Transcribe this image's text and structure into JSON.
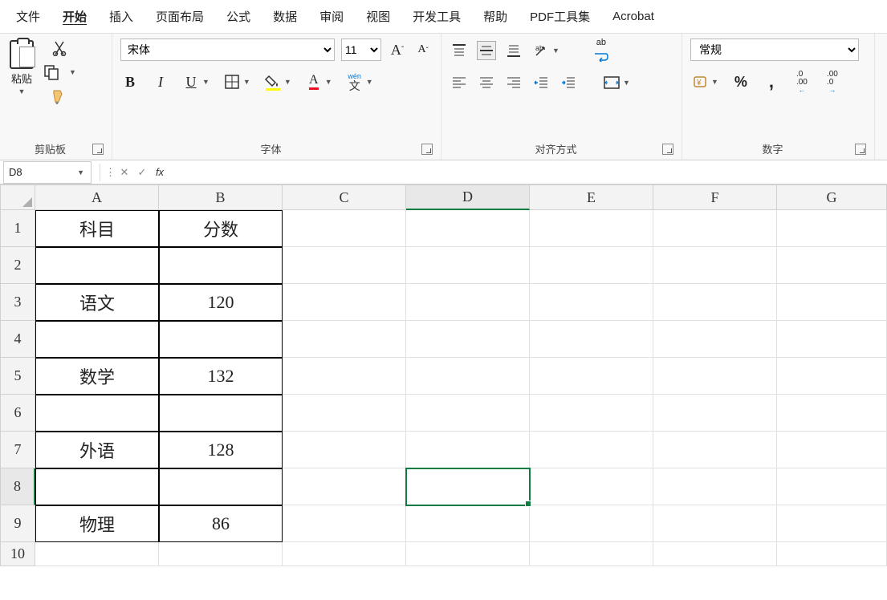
{
  "tabs": [
    "文件",
    "开始",
    "插入",
    "页面布局",
    "公式",
    "数据",
    "审阅",
    "视图",
    "开发工具",
    "帮助",
    "PDF工具集",
    "Acrobat"
  ],
  "active_tab": 1,
  "ribbon": {
    "clipboard": {
      "paste": "粘贴",
      "label": "剪贴板"
    },
    "font": {
      "name": "宋体",
      "size": "11",
      "bold": "B",
      "italic": "I",
      "underline": "U",
      "pinyin": "wén",
      "pinyin2": "文",
      "label": "字体"
    },
    "align": {
      "wrap": "ab",
      "label": "对齐方式"
    },
    "number": {
      "format": "常规",
      "label": "数字"
    }
  },
  "namebox": "D8",
  "formula": "",
  "columns": [
    {
      "letter": "A",
      "width": 154
    },
    {
      "letter": "B",
      "width": 154
    },
    {
      "letter": "C",
      "width": 154
    },
    {
      "letter": "D",
      "width": 154
    },
    {
      "letter": "E",
      "width": 154
    },
    {
      "letter": "F",
      "width": 154
    },
    {
      "letter": "G",
      "width": 137
    }
  ],
  "selected_col": "D",
  "selected_row": 8,
  "rows": [
    {
      "n": 1,
      "A": "科目",
      "B": "分数",
      "bordered": true
    },
    {
      "n": 2,
      "A": "",
      "B": "",
      "bordered": true
    },
    {
      "n": 3,
      "A": "语文",
      "B": "120",
      "bordered": true
    },
    {
      "n": 4,
      "A": "",
      "B": "",
      "bordered": true
    },
    {
      "n": 5,
      "A": "数学",
      "B": "132",
      "bordered": true
    },
    {
      "n": 6,
      "A": "",
      "B": "",
      "bordered": true
    },
    {
      "n": 7,
      "A": "外语",
      "B": "128",
      "bordered": true
    },
    {
      "n": 8,
      "A": "",
      "B": "",
      "bordered": true
    },
    {
      "n": 9,
      "A": "物理",
      "B": "86",
      "bordered": true
    },
    {
      "n": 10,
      "A": "",
      "B": "",
      "bordered": false,
      "short": true
    }
  ]
}
